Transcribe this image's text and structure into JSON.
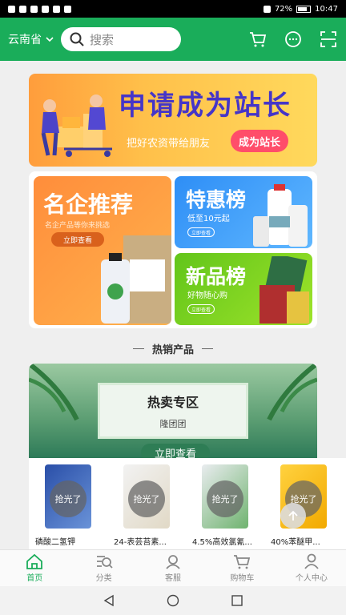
{
  "status_bar": {
    "battery": "72%",
    "time": "10:47"
  },
  "header": {
    "province": "云南省",
    "search_placeholder": "搜索"
  },
  "banner_station": {
    "title": "申请成为站长",
    "subtitle": "把好农资带给朋友",
    "button": "成为站长"
  },
  "grid": {
    "famous": {
      "title": "名企推荐",
      "subtitle": "名企产品等你来挑选",
      "button": "立即查看"
    },
    "deal": {
      "title": "特惠榜",
      "subtitle": "低至10元起",
      "button": "立即查看"
    },
    "new": {
      "title": "新品榜",
      "subtitle": "好物随心购",
      "button": "立即查看"
    }
  },
  "section": {
    "title": "热销产品"
  },
  "hot_banner": {
    "title": "热卖专区",
    "subtitle": "隆团团",
    "button": "立即查看"
  },
  "products": [
    {
      "name": "磷酸二氢钾",
      "badge": "抢光了"
    },
    {
      "name": "24-表芸苔素...",
      "badge": "抢光了"
    },
    {
      "name": "4.5%高效氯氰...",
      "badge": "抢光了"
    },
    {
      "name": "40%苯醚甲...",
      "badge": "抢光了"
    }
  ],
  "tabs": [
    {
      "label": "首页"
    },
    {
      "label": "分类"
    },
    {
      "label": "客服"
    },
    {
      "label": "购物车"
    },
    {
      "label": "个人中心"
    }
  ],
  "colors": {
    "brand_green": "#1aad5a",
    "accent_red": "#ff4d6a",
    "title_purple": "#4535c8"
  }
}
